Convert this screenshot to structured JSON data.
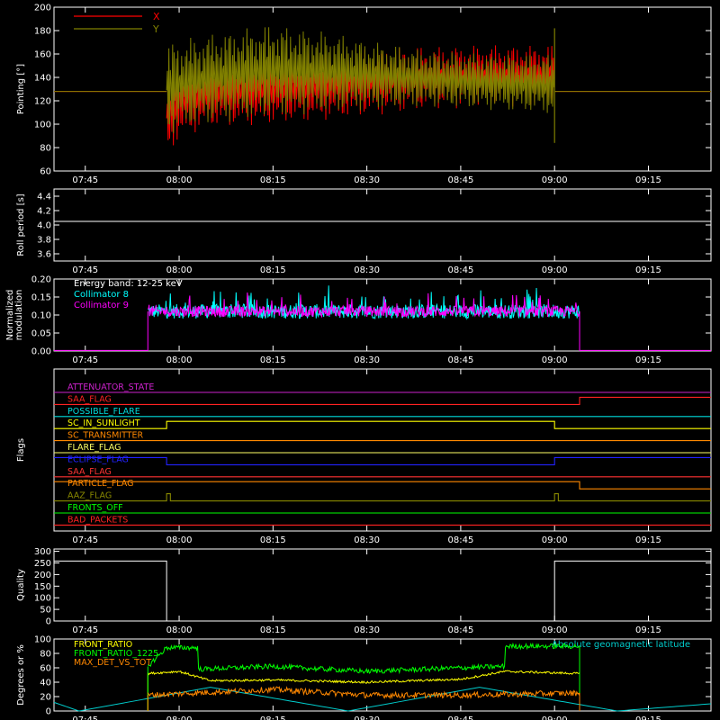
{
  "figure": {
    "background": "#000000",
    "axis_color": "#ffffff"
  },
  "time_axis": {
    "xlim": [
      "07:40",
      "09:25"
    ],
    "ticks": [
      "07:45",
      "08:00",
      "08:15",
      "08:30",
      "08:45",
      "09:00",
      "09:15"
    ]
  },
  "chart_data": [
    {
      "id": "pointing",
      "type": "line",
      "ylabel": "Pointing [°]",
      "ylim": [
        60,
        200
      ],
      "yticks": [
        "60",
        "80",
        "100",
        "120",
        "140",
        "160",
        "180",
        "200"
      ],
      "legend": "top-left",
      "series": [
        {
          "name": "X",
          "color": "#ff0000",
          "envelope": {
            "x": [
              "07:58",
              "08:00",
              "08:05",
              "08:15",
              "08:25",
              "08:30",
              "08:40",
              "08:50",
              "09:00"
            ],
            "upper": [
              140,
              150,
              155,
              160,
              163,
              165,
              167,
              168,
              168
            ],
            "lower": [
              70,
              88,
              97,
              100,
              104,
              107,
              112,
              115,
              115
            ]
          },
          "baseline": 128
        },
        {
          "name": "Y",
          "color": "#808000",
          "envelope": {
            "x": [
              "07:58",
              "08:00",
              "08:05",
              "08:15",
              "08:25",
              "08:30",
              "08:40",
              "08:50",
              "09:00"
            ],
            "upper": [
              170,
              172,
              178,
              186,
              178,
              172,
              163,
              160,
              160
            ],
            "lower": [
              88,
              95,
              100,
              106,
              110,
              112,
              115,
              112,
              108
            ]
          },
          "baseline": 128
        }
      ]
    },
    {
      "id": "roll",
      "type": "line",
      "ylabel": "Roll period [s]",
      "ylim": [
        3.5,
        4.5
      ],
      "yticks": [
        "3.6",
        "3.8",
        "4.0",
        "4.2",
        "4.4"
      ],
      "series": [
        {
          "color": "#ffffff",
          "x": [
            "07:40",
            "09:25"
          ],
          "y": [
            4.05,
            4.05
          ]
        }
      ]
    },
    {
      "id": "modulation",
      "type": "line",
      "ylabel": "Normalized modulation",
      "ylim": [
        0,
        0.2
      ],
      "yticks": [
        "0.00",
        "0.05",
        "0.10",
        "0.15",
        "0.20"
      ],
      "legend": "top-left",
      "annotation": "Energy band: 12-25 keV",
      "active": [
        "07:55",
        "09:04"
      ],
      "series": [
        {
          "name": "Collimator 8",
          "color": "#00ffff",
          "mean": 0.11,
          "spread": 0.04
        },
        {
          "name": "Collimator 9",
          "color": "#ff00ff",
          "mean": 0.11,
          "spread": 0.03
        }
      ]
    },
    {
      "id": "flags",
      "type": "line",
      "ylabel": "Flags",
      "flags": [
        {
          "name": "ATTENUATOR_STATE",
          "color": "#cc22cc",
          "changes": []
        },
        {
          "name": "SAA_FLAG",
          "color": "#ff2222",
          "changes": [
            "09:04"
          ]
        },
        {
          "name": "POSSIBLE_FLARE",
          "color": "#00dddd",
          "changes": []
        },
        {
          "name": "SC_IN_SUNLIGHT",
          "color": "#ffff00",
          "changes": [
            "07:58",
            "09:00"
          ]
        },
        {
          "name": "SC_TRANSMITTER",
          "color": "#ff8800",
          "changes": []
        },
        {
          "name": "FLARE_FLAG",
          "color": "#ffff66",
          "changes": []
        },
        {
          "name": "ECLIPSE_FLAG",
          "color": "#2222ff",
          "changes": [
            "07:58",
            "09:00"
          ]
        },
        {
          "name": "SAA_FLAG",
          "color": "#ff3333",
          "changes": []
        },
        {
          "name": "PARTICLE_FLAG",
          "color": "#ff8800",
          "changes": [
            "09:04"
          ]
        },
        {
          "name": "AAZ_FLAG",
          "color": "#888800",
          "changes": [
            "07:58",
            "09:00"
          ]
        },
        {
          "name": "FRONTS_OFF",
          "color": "#00ff00",
          "changes": []
        },
        {
          "name": "BAD_PACKETS",
          "color": "#ff2222",
          "changes": []
        }
      ]
    },
    {
      "id": "quality",
      "type": "line",
      "ylabel": "Quality",
      "ylim": [
        0,
        310
      ],
      "yticks": [
        "0",
        "50",
        "100",
        "150",
        "200",
        "250",
        "300"
      ],
      "series": [
        {
          "color": "#ffffff",
          "x": [
            "07:40",
            "07:58",
            "07:58",
            "09:00",
            "09:00",
            "09:25"
          ],
          "y": [
            258,
            258,
            0,
            0,
            258,
            258
          ]
        }
      ]
    },
    {
      "id": "degrees",
      "type": "line",
      "ylabel": "Degrees or %",
      "ylim": [
        0,
        100
      ],
      "yticks": [
        "0",
        "20",
        "40",
        "60",
        "80",
        "100"
      ],
      "legend": "top-left",
      "series": [
        {
          "name": "FRONT_RATIO",
          "color": "#ffff00",
          "x": [
            "07:55",
            "08:00",
            "08:05",
            "08:15",
            "08:30",
            "08:45",
            "08:52",
            "09:04"
          ],
          "y": [
            52,
            55,
            42,
            43,
            40,
            44,
            55,
            52
          ]
        },
        {
          "name": "FRONT_RATIO_1225",
          "color": "#00ff00",
          "x": [
            "07:55",
            "07:58",
            "08:03",
            "08:03",
            "08:15",
            "08:30",
            "08:45",
            "08:52",
            "08:52",
            "09:04"
          ],
          "y": [
            62,
            88,
            88,
            58,
            62,
            55,
            60,
            62,
            90,
            90
          ]
        },
        {
          "name": "MAX_DET_VS_TOT",
          "color": "#ff8800",
          "x": [
            "07:55",
            "08:00",
            "08:15",
            "08:30",
            "08:45",
            "09:04"
          ],
          "y": [
            22,
            24,
            30,
            22,
            22,
            25
          ]
        }
      ],
      "extra_series": {
        "name": "Absolute geomagnetic latitude",
        "color": "#00cccc",
        "legend": "top-right",
        "x": [
          "07:40",
          "07:44",
          "08:05",
          "08:27",
          "08:48",
          "09:10",
          "09:25"
        ],
        "y": [
          12,
          0,
          33,
          0,
          33,
          0,
          10
        ]
      }
    }
  ]
}
